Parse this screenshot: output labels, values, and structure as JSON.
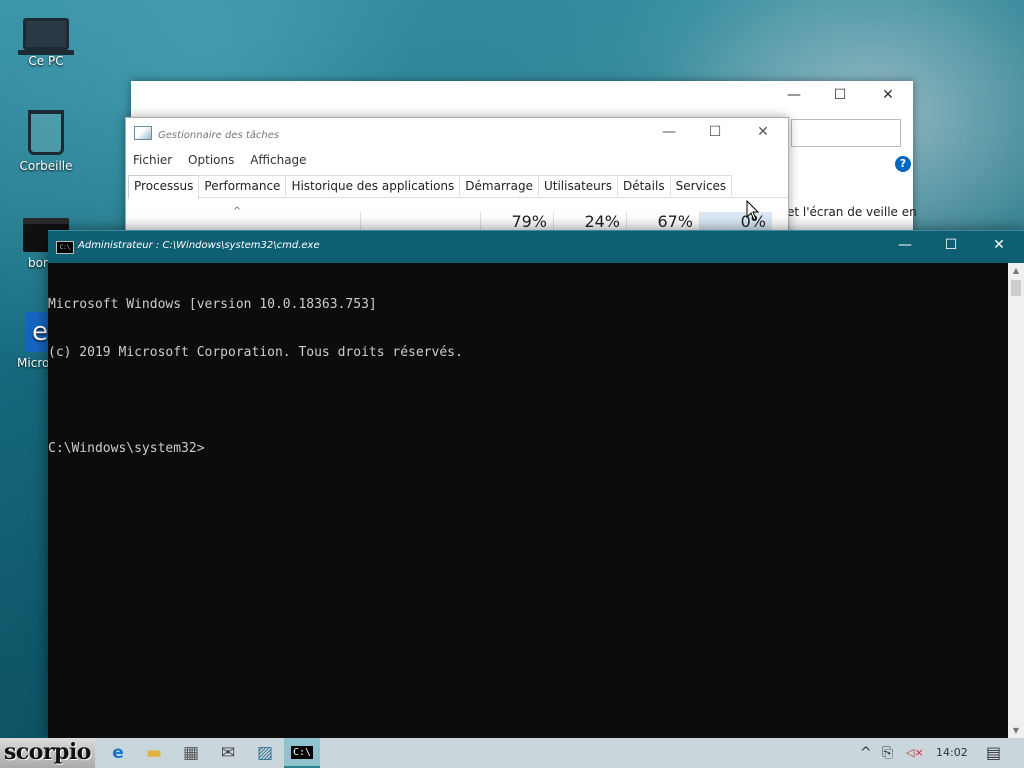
{
  "desktop": {
    "icons": [
      {
        "label": "Ce PC",
        "icon": "computer-icon"
      },
      {
        "label": "Corbeille",
        "icon": "recycle-bin-icon"
      },
      {
        "label": "bor",
        "icon": "folder-icon"
      },
      {
        "label": "Microso",
        "icon": "edge-shortcut-icon"
      }
    ]
  },
  "settings_window": {
    "controls": {
      "minimize": "—",
      "maximize": "☐",
      "close": "✕"
    },
    "help": "?",
    "snippet": "et l'écran de veille en"
  },
  "task_manager": {
    "title": "Gestionnaire des tâches",
    "controls": {
      "minimize": "—",
      "maximize": "☐",
      "close": "✕"
    },
    "menu": [
      "Fichier",
      "Options",
      "Affichage"
    ],
    "tabs": [
      "Processus",
      "Performance",
      "Historique des applications",
      "Démarrage",
      "Utilisateurs",
      "Détails",
      "Services"
    ],
    "active_tab": "Processus",
    "sort_indicator": "^",
    "columns": [
      {
        "value": "79%"
      },
      {
        "value": "24%"
      },
      {
        "value": "67%"
      },
      {
        "value": "0%"
      }
    ]
  },
  "cmd": {
    "title": "Administrateur : C:\\Windows\\system32\\cmd.exe",
    "icon_text": "C:\\",
    "controls": {
      "minimize": "—",
      "maximize": "☐",
      "close": "✕"
    },
    "lines": [
      "Microsoft Windows [version 10.0.18363.753]",
      "(c) 2019 Microsoft Corporation. Tous droits réservés.",
      "",
      "C:\\Windows\\system32>"
    ],
    "scroll_up": "▲",
    "scroll_down": "▼"
  },
  "taskbar": {
    "brand": "scorpio",
    "buttons": [
      {
        "name": "edge",
        "icon": "e"
      },
      {
        "name": "file-explorer",
        "icon": "▬"
      },
      {
        "name": "store",
        "icon": "▦"
      },
      {
        "name": "mail",
        "icon": "✉"
      },
      {
        "name": "task-manager",
        "icon": "▨"
      },
      {
        "name": "cmd",
        "icon": "C:\\"
      }
    ],
    "tray": {
      "chevron": "^",
      "network": "⎘",
      "volume": "◁×",
      "clock": "14:02",
      "notifications": "▤"
    }
  }
}
